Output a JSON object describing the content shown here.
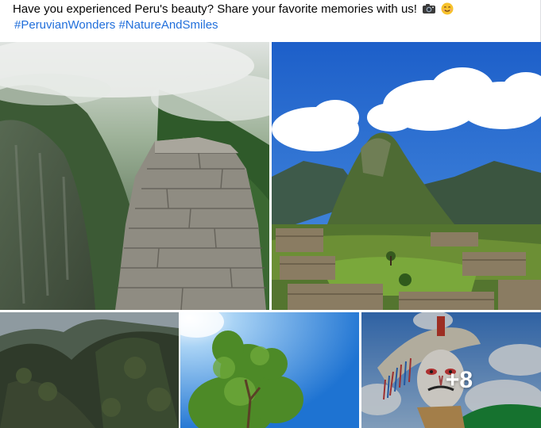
{
  "post": {
    "caption": "Have you experienced Peru's beauty? Share your favorite memories with us!",
    "caption_emojis": [
      "camera-icon",
      "smiling-face-icon"
    ],
    "hashtags": [
      "#PeruvianWonders",
      "#NatureAndSmiles"
    ]
  },
  "gallery": {
    "photos": [
      {
        "subject": "stone-ruin-wall-in-misty-mountains"
      },
      {
        "subject": "machu-picchu-under-blue-sky"
      },
      {
        "subject": "forested-mountain-slopes"
      },
      {
        "subject": "green-tree-against-blue-sky"
      },
      {
        "subject": "masked-dancer-in-costume"
      }
    ],
    "more_count": "+8"
  },
  "colors": {
    "hashtag": "#216fdb",
    "text": "#050505"
  }
}
